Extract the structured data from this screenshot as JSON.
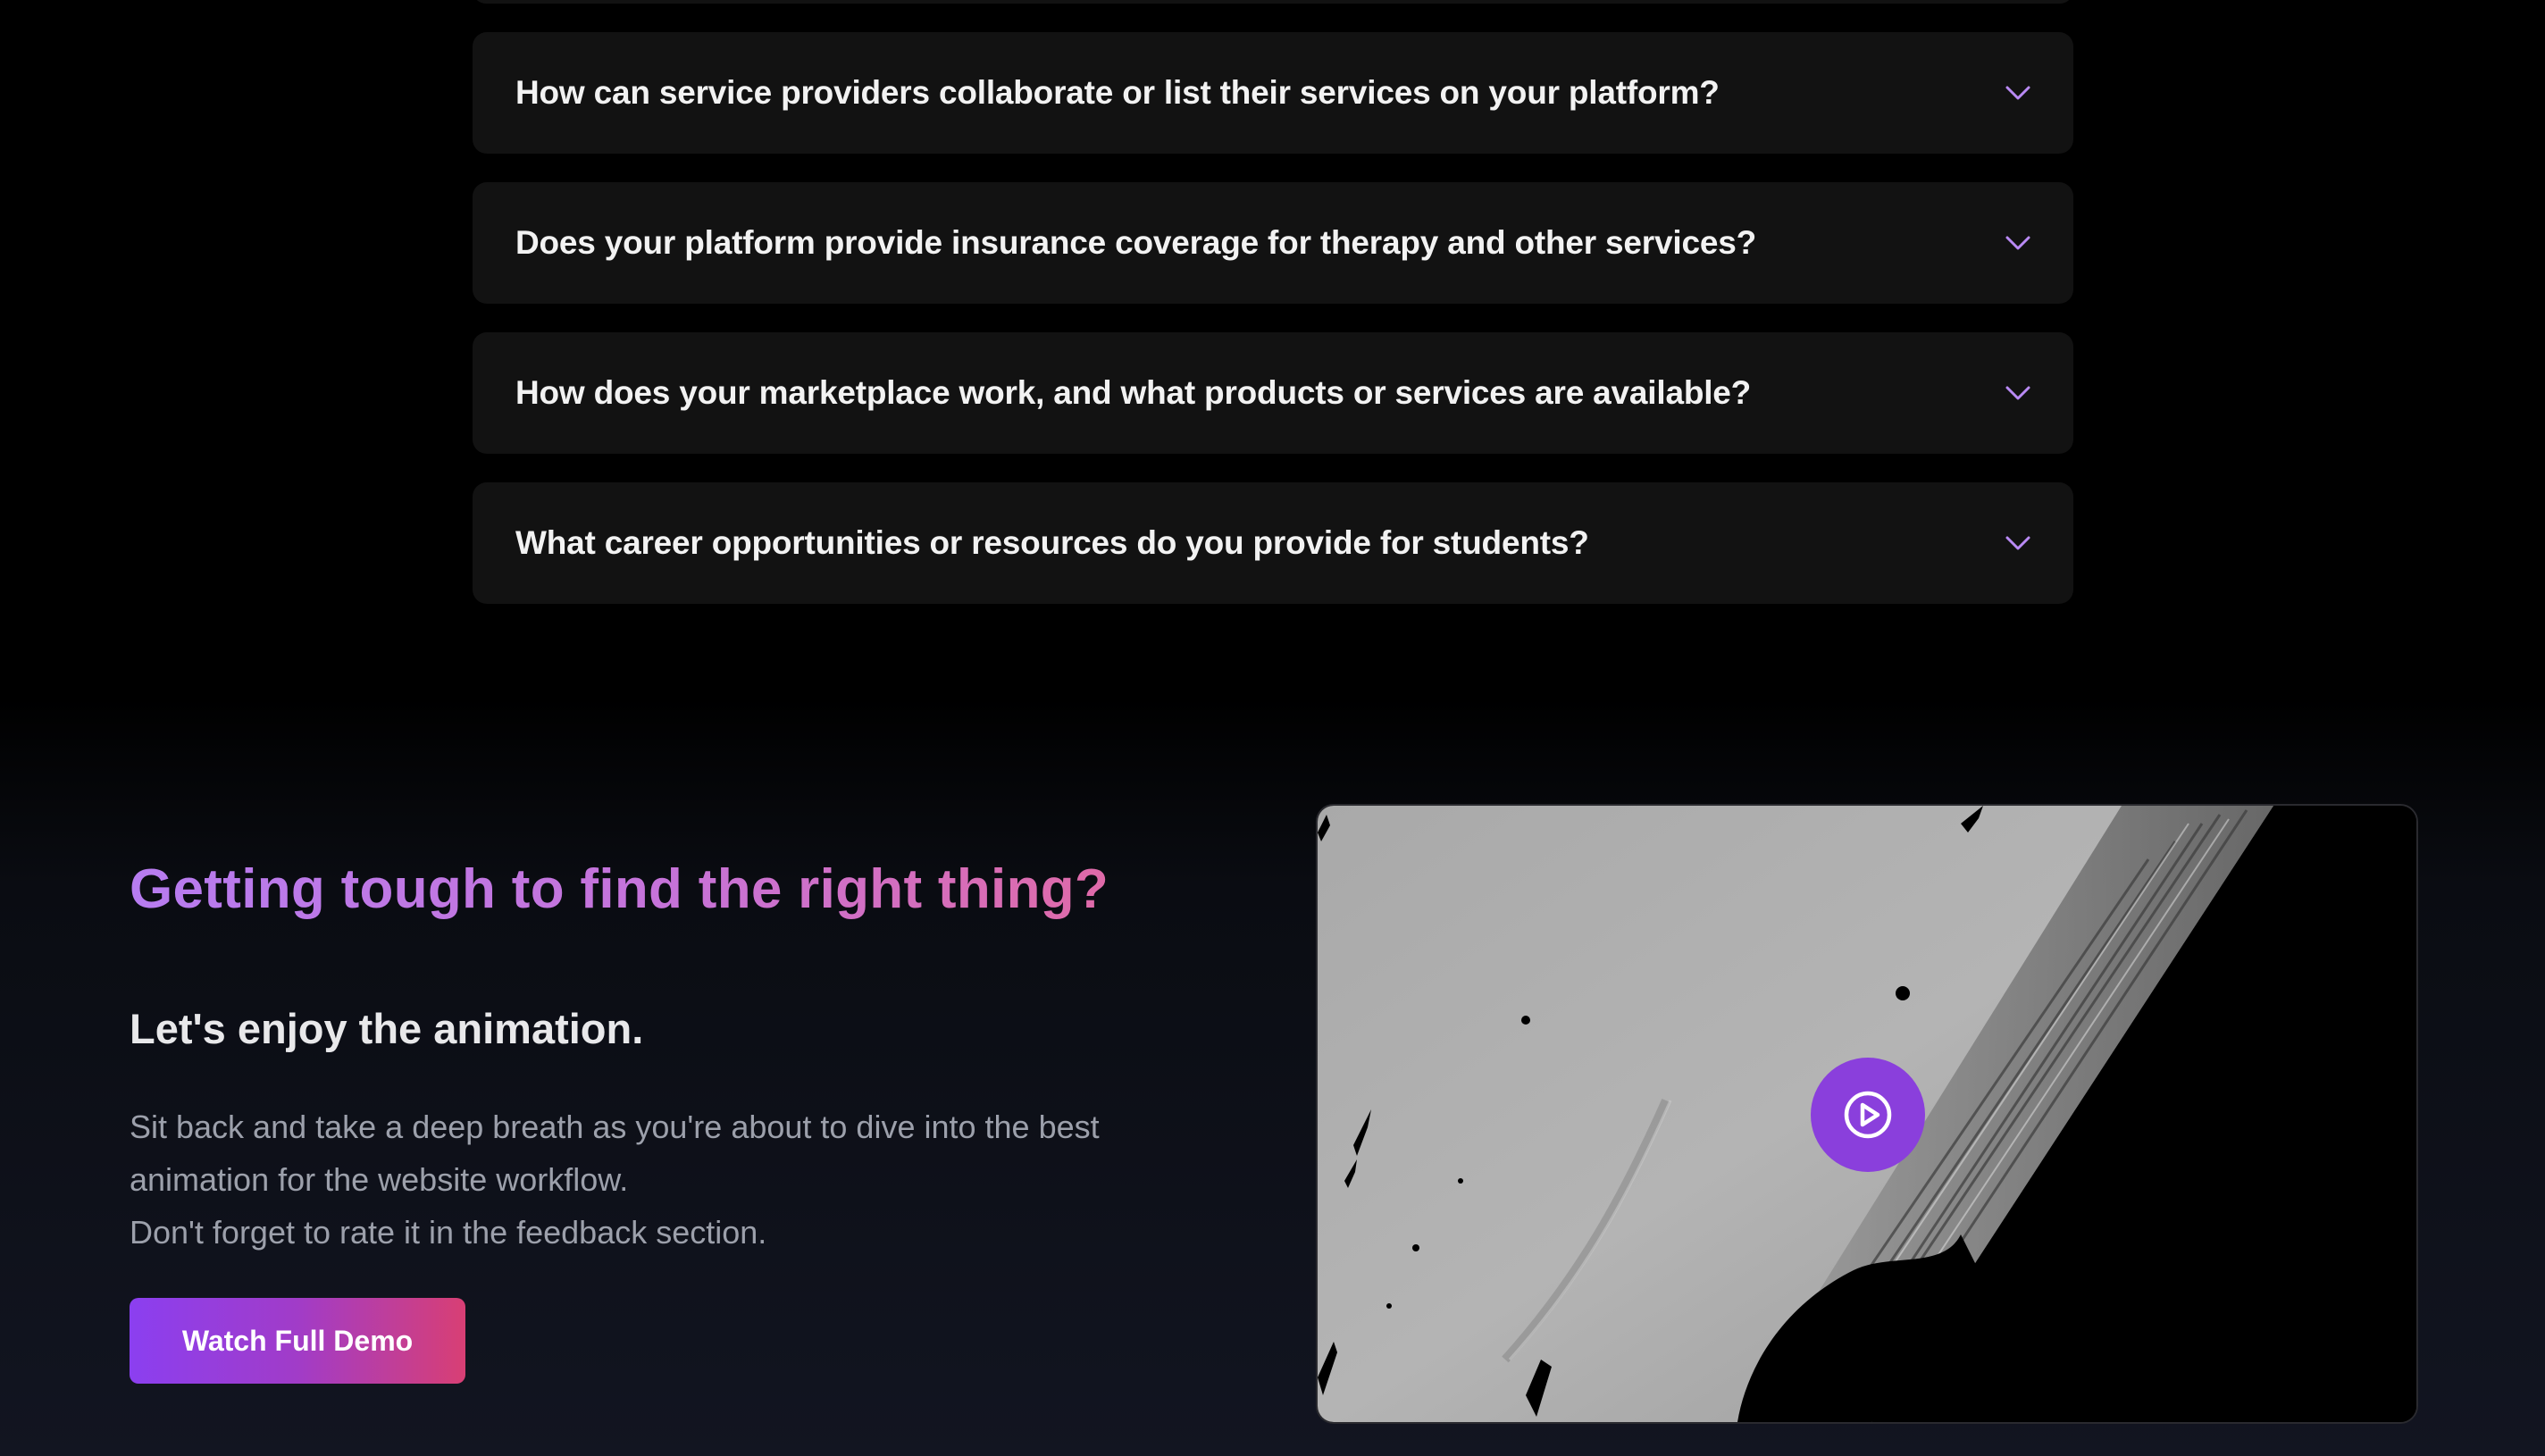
{
  "faq": {
    "items": [
      {
        "question": "How can service providers collaborate or list their services on your platform?"
      },
      {
        "question": "Does your platform provide insurance coverage for therapy and other services?"
      },
      {
        "question": "How does your marketplace work, and what products or services are available?"
      },
      {
        "question": "What career opportunities or resources do you provide for students?"
      }
    ],
    "chevron_icon": "chevron-down-icon",
    "accent_color": "#b98af5"
  },
  "demo": {
    "headline": "Getting tough to find the right thing?",
    "subheading": "Let's enjoy the animation.",
    "paragraph_lines": [
      "Sit back and take a deep breath as you're about to dive into the best",
      "animation for the website workflow.",
      "Don't forget to rate it in the feedback section."
    ],
    "cta_label": "Watch Full Demo",
    "play_icon": "play-circle-icon",
    "colors": {
      "headline_gradient_start": "#b77cf0",
      "headline_gradient_end": "#df6aa8",
      "cta_gradient_start": "#8b3ff0",
      "cta_gradient_end": "#d83f74",
      "play_button": "#8a3fdc"
    }
  }
}
